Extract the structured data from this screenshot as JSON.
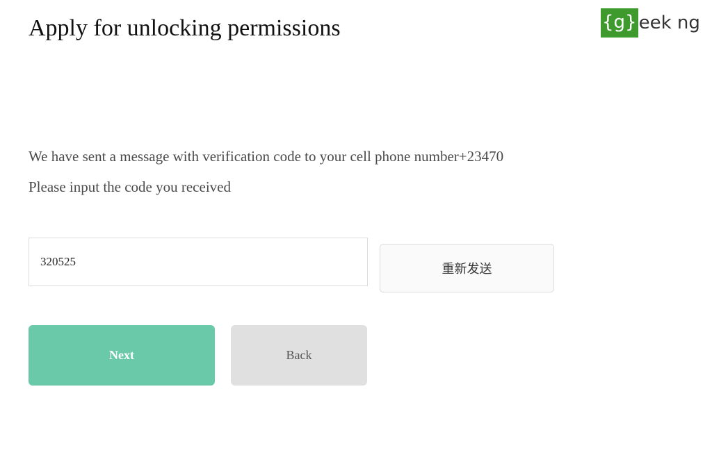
{
  "header": {
    "title": "Apply for unlocking permissions"
  },
  "logo": {
    "box_text": "{g}",
    "rest_text": "eek ng",
    "brand_color": "#3f9a2e"
  },
  "verification": {
    "message_line_1": "We have sent a message with verification code to your cell phone number+23470",
    "message_line_2": "Please input the code you received",
    "code_value": "320525",
    "resend_label": "重新发送"
  },
  "actions": {
    "next_label": "Next",
    "back_label": "Back",
    "next_color": "#69c9a8",
    "back_color": "#e0e0e0"
  }
}
